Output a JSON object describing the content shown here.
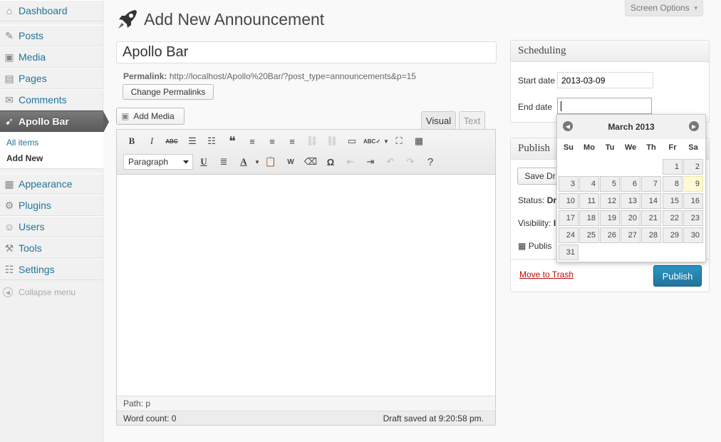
{
  "menu": {
    "items": [
      {
        "label": "Dashboard",
        "icon": "dashboard-icon",
        "glyph": "⌂"
      },
      {
        "label": "Posts",
        "icon": "pin-icon",
        "glyph": "✎"
      },
      {
        "label": "Media",
        "icon": "media-icon",
        "glyph": "▣"
      },
      {
        "label": "Pages",
        "icon": "pages-icon",
        "glyph": "▤"
      },
      {
        "label": "Comments",
        "icon": "comments-icon",
        "glyph": "✉"
      },
      {
        "label": "Apollo Bar",
        "icon": "rocket-icon",
        "glyph": "➹"
      },
      {
        "label": "Appearance",
        "icon": "appearance-icon",
        "glyph": "▦"
      },
      {
        "label": "Plugins",
        "icon": "plugins-icon",
        "glyph": "⚙"
      },
      {
        "label": "Users",
        "icon": "users-icon",
        "glyph": "☺"
      },
      {
        "label": "Tools",
        "icon": "tools-icon",
        "glyph": "⚒"
      },
      {
        "label": "Settings",
        "icon": "settings-icon",
        "glyph": "☷"
      }
    ],
    "submenu": [
      {
        "label": "All items"
      },
      {
        "label": "Add New"
      }
    ],
    "collapse_label": "Collapse menu"
  },
  "header": {
    "title": "Add New Announcement",
    "screen_options": "Screen Options"
  },
  "post": {
    "title_value": "Apollo Bar",
    "permalink_label": "Permalink:",
    "permalink_url": "http://localhost/Apollo%20Bar/?post_type=announcements&p=15",
    "change_permalinks": "Change Permalinks",
    "add_media": "Add Media"
  },
  "editor": {
    "tab_visual": "Visual",
    "tab_text": "Text",
    "format_select": "Paragraph",
    "path": "Path: p",
    "word_count": "Word count: 0",
    "draft_saved": "Draft saved at 9:20:58 pm."
  },
  "scheduling": {
    "heading": "Scheduling",
    "start_label": "Start date",
    "start_value": "2013-03-09",
    "end_label": "End date",
    "end_value": ""
  },
  "publish": {
    "heading": "Publish",
    "save_draft": "Save Dr",
    "status_label": "Status:",
    "status_value": "Dr",
    "visibility_label": "Visibility:",
    "visibility_value": "I",
    "publish_immediately": "Publis",
    "move_to_trash": "Move to Trash",
    "publish_button": "Publish"
  },
  "datepicker": {
    "title": "March 2013",
    "weekdays": [
      "Su",
      "Mo",
      "Tu",
      "We",
      "Th",
      "Fr",
      "Sa"
    ],
    "first_weekday_index": 5,
    "days_in_month": 31,
    "today": 9
  },
  "colors": {
    "link": "#21759b",
    "active_menu": "#5a5a5a",
    "publish_button": "#21759b",
    "trash": "#bc0b0b",
    "today_highlight": "#fdfbd6"
  }
}
